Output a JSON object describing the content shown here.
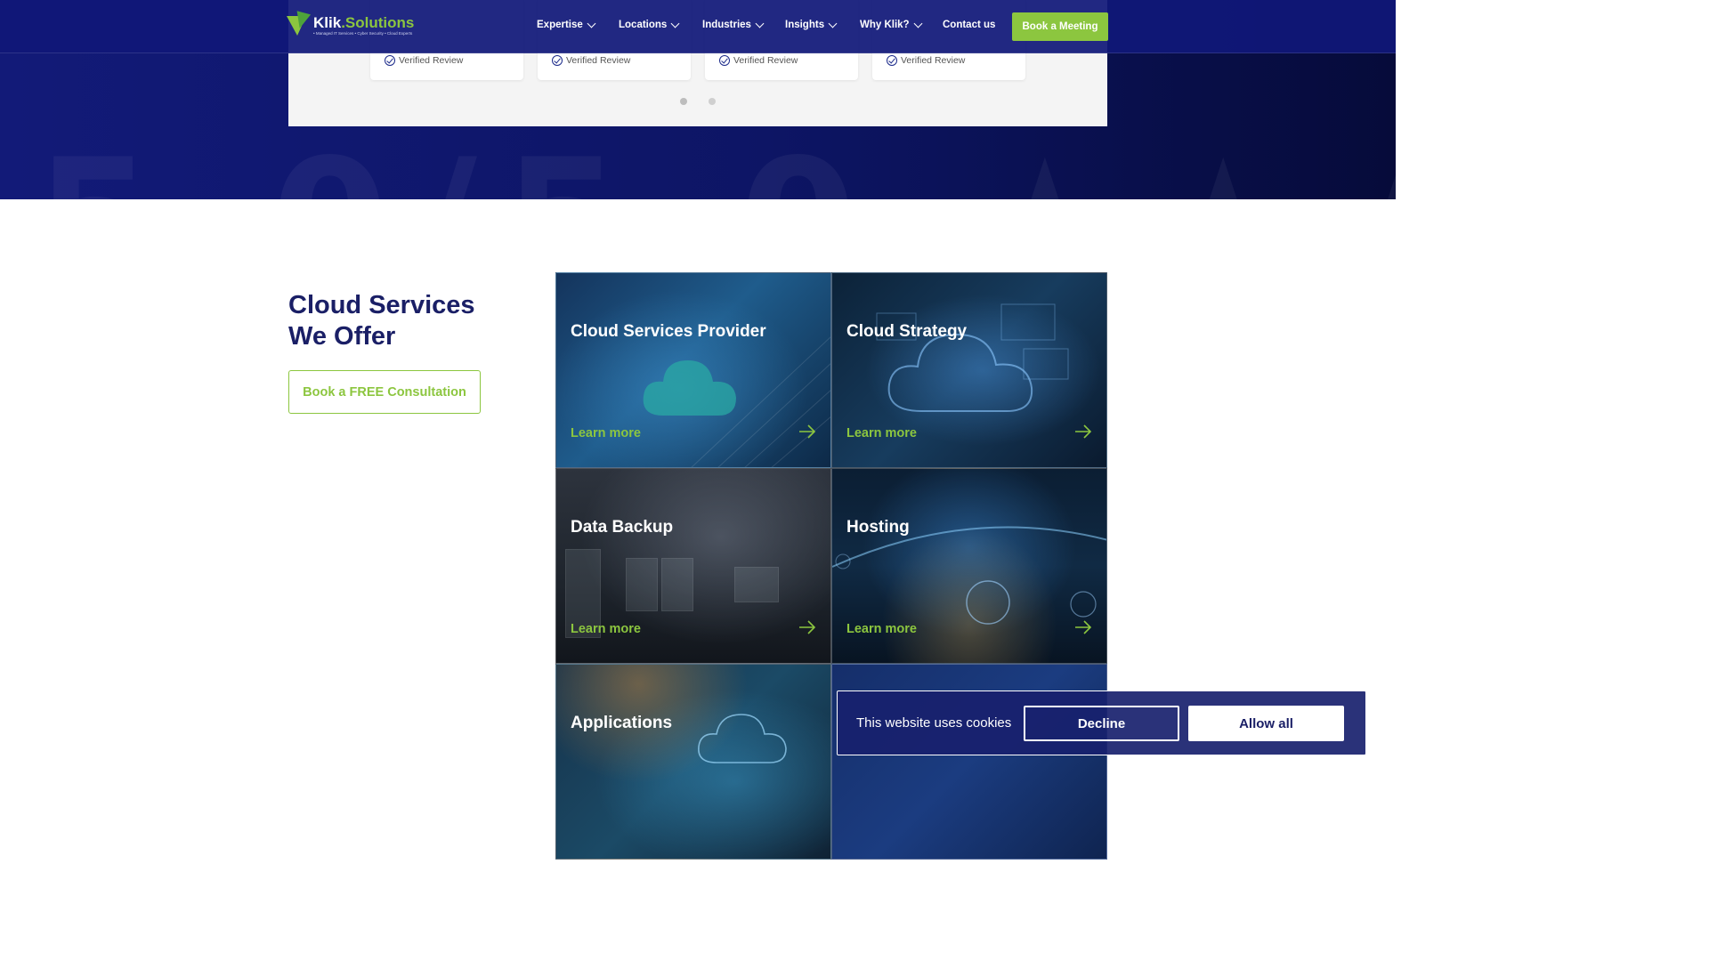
{
  "brand": {
    "name_white": "Klik",
    "name_green": ".Solutions",
    "tagline": "• Managed IT Services • Cyber Security • Cloud Experts",
    "accent": "#8cc63f",
    "navy": "#1a1f66"
  },
  "nav": {
    "items": [
      {
        "label": "Expertise",
        "dropdown": true
      },
      {
        "label": "Locations",
        "dropdown": true
      },
      {
        "label": "Industries",
        "dropdown": true
      },
      {
        "label": "Insights",
        "dropdown": true
      },
      {
        "label": "Why Klik?",
        "dropdown": true
      },
      {
        "label": "Contact us",
        "dropdown": false
      }
    ],
    "cta": "Book a Meeting"
  },
  "reviews": {
    "verified_label": "Verified Review",
    "cards": 4,
    "pagination": {
      "pages": 2,
      "active": 1
    }
  },
  "section": {
    "title_line1": "Cloud Services",
    "title_line2": "We Offer",
    "consult_button": "Book a FREE Consultation"
  },
  "services": [
    {
      "title": "Cloud Services Provider",
      "link": "Learn more"
    },
    {
      "title": "Cloud Strategy",
      "link": "Learn more"
    },
    {
      "title": "Data Backup",
      "link": "Learn more"
    },
    {
      "title": "Hosting",
      "link": "Learn more"
    },
    {
      "title": "Applications",
      "link": ""
    },
    {
      "title": "",
      "link": ""
    }
  ],
  "cookie_banner": {
    "message": "This website uses cookies",
    "decline": "Decline",
    "allow": "Allow all"
  }
}
